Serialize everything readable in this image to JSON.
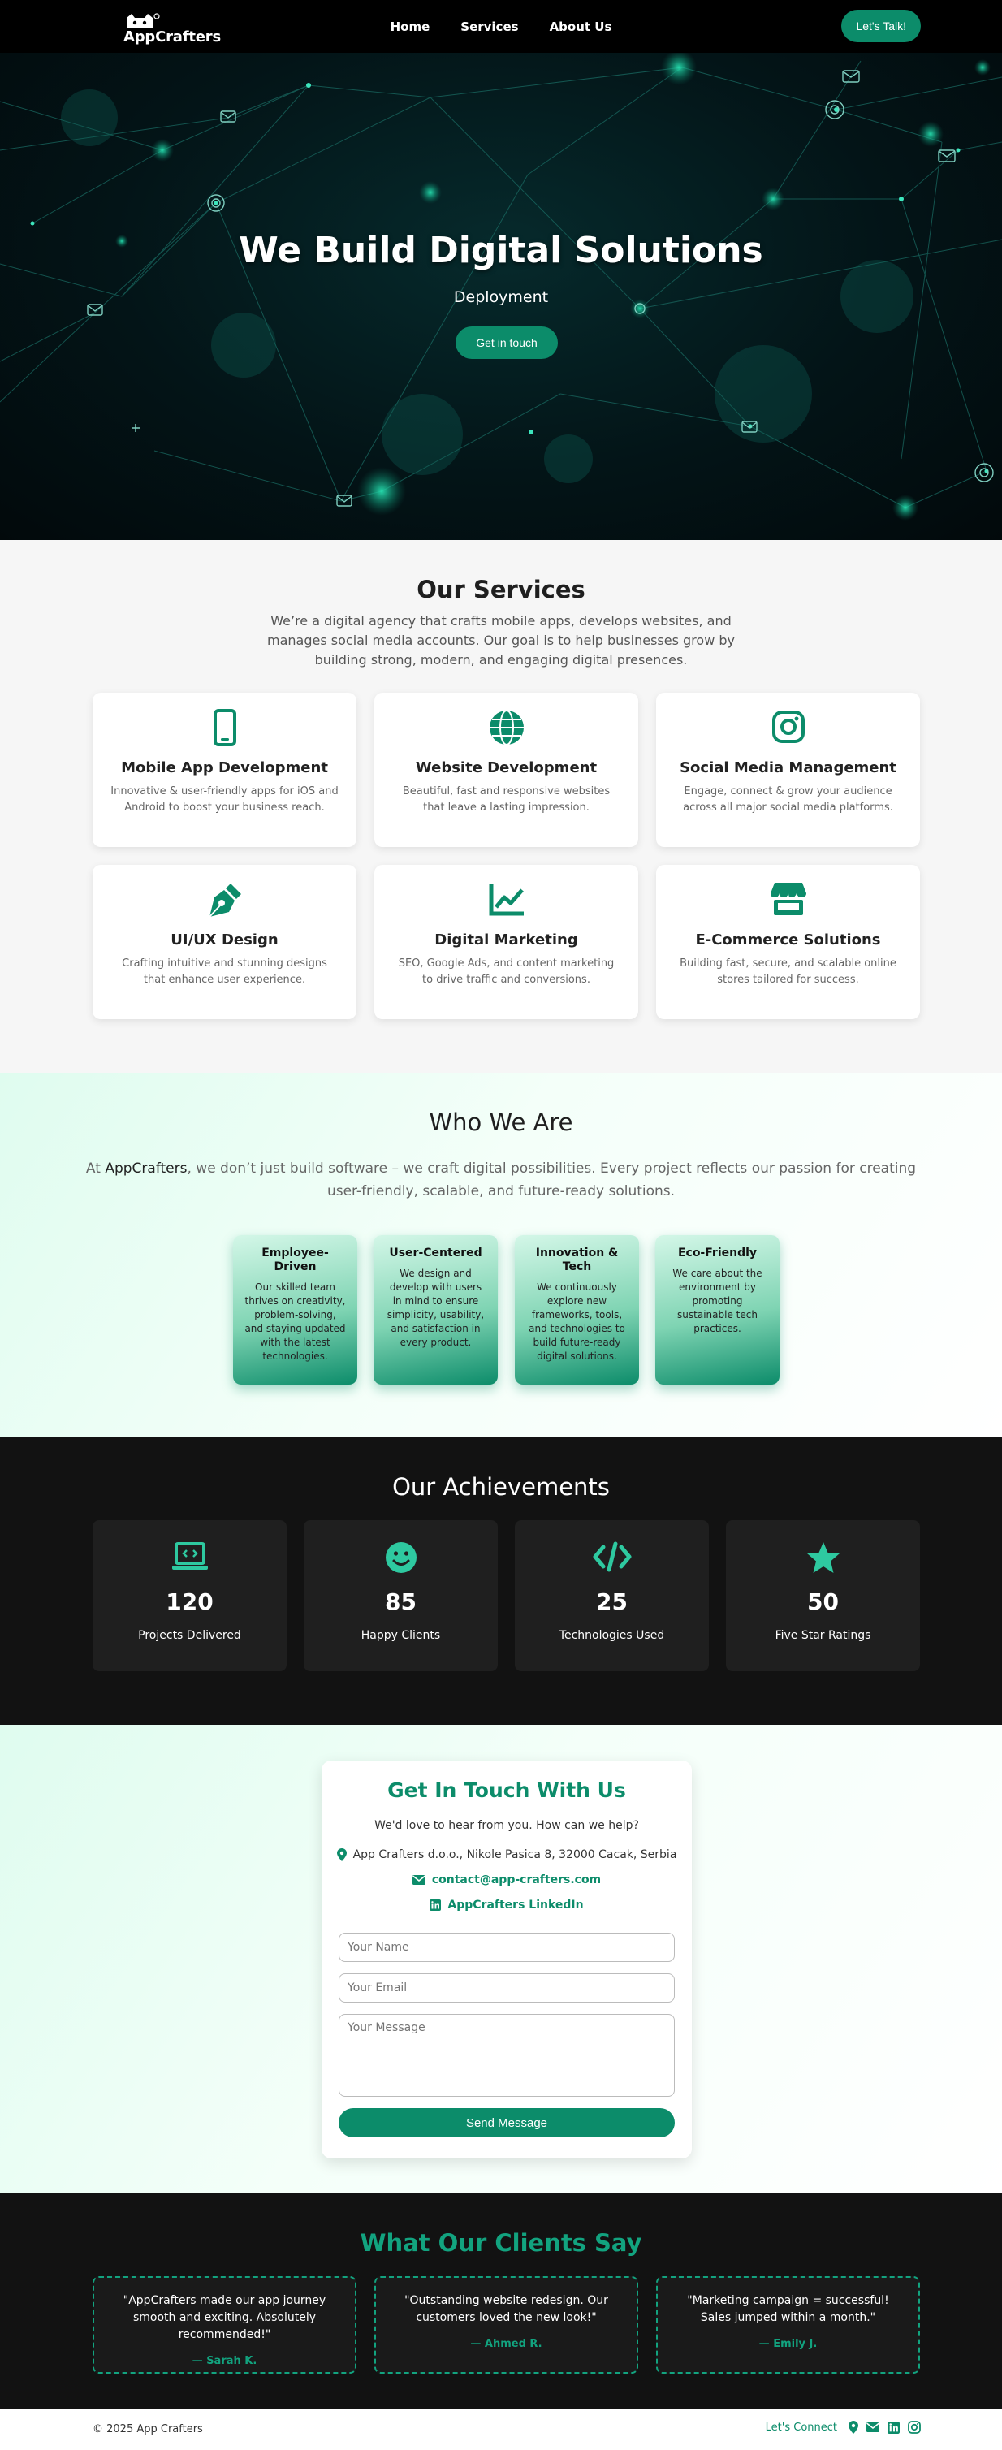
{
  "nav": {
    "logo_text": "AppCrafters",
    "links": [
      "Home",
      "Services",
      "About Us"
    ],
    "cta": "Let's Talk!"
  },
  "hero": {
    "title": "We Build Digital Solutions",
    "subtitle": "Deployment",
    "button": "Get in touch"
  },
  "services": {
    "title": "Our Services",
    "intro": "We’re a digital agency that crafts mobile apps, develops websites, and manages social media accounts. Our goal is to help businesses grow by building strong, modern, and engaging digital presences.",
    "items": [
      {
        "icon": "mobile-phone-icon",
        "title": "Mobile App Development",
        "desc": "Innovative & user-friendly apps for iOS and Android to boost your business reach."
      },
      {
        "icon": "globe-icon",
        "title": "Website Development",
        "desc": "Beautiful, fast and responsive websites that leave a lasting impression."
      },
      {
        "icon": "instagram-icon",
        "title": "Social Media Management",
        "desc": "Engage, connect & grow your audience across all major social media platforms."
      },
      {
        "icon": "pen-nib-icon",
        "title": "UI/UX Design",
        "desc": "Crafting intuitive and stunning designs that enhance user experience."
      },
      {
        "icon": "chart-line-icon",
        "title": "Digital Marketing",
        "desc": "SEO, Google Ads, and content marketing to drive traffic and conversions."
      },
      {
        "icon": "store-icon",
        "title": "E-Commerce Solutions",
        "desc": "Building fast, secure, and scalable online stores tailored for success."
      }
    ]
  },
  "who": {
    "title": "Who We Are",
    "intro_prefix": "At ",
    "intro_brand": "AppCrafters",
    "intro_rest": ", we don’t just build software – we craft digital possibilities. Every project reflects our passion for creating user-friendly, scalable, and future-ready solutions.",
    "values": [
      {
        "title": "Employee-Driven",
        "desc": "Our skilled team thrives on creativity, problem-solving, and staying updated with the latest technologies."
      },
      {
        "title": "User-Centered",
        "desc": "We design and develop with users in mind to ensure simplicity, usability, and satisfaction in every product."
      },
      {
        "title": "Innovation & Tech",
        "desc": "We continuously explore new frameworks, tools, and technologies to build future-ready digital solutions."
      },
      {
        "title": "Eco-Friendly",
        "desc": "We care about the environment by promoting sustainable tech practices."
      }
    ]
  },
  "achievements": {
    "title": "Our Achievements",
    "items": [
      {
        "icon": "laptop-code-icon",
        "number": "120",
        "label": "Projects Delivered"
      },
      {
        "icon": "smile-icon",
        "number": "85",
        "label": "Happy Clients"
      },
      {
        "icon": "code-icon",
        "number": "25",
        "label": "Technologies Used"
      },
      {
        "icon": "star-icon",
        "number": "50",
        "label": "Five Star Ratings"
      }
    ]
  },
  "contact": {
    "title": "Get In Touch With Us",
    "lead": "We'd love to hear from you. How can we help?",
    "address": "App Crafters d.o.o., Nikole Pasica 8, 32000 Cacak, Serbia",
    "email": "contact@app-crafters.com",
    "linkedin": "AppCrafters LinkedIn",
    "name_placeholder": "Your Name",
    "email_placeholder": "Your Email",
    "message_placeholder": "Your Message",
    "send": "Send Message"
  },
  "testimonials": {
    "title": "What Our Clients Say",
    "items": [
      {
        "quote": "\"AppCrafters made our app journey smooth and exciting. Absolutely recommended!\"",
        "author": "— Sarah K."
      },
      {
        "quote": "\"Outstanding website redesign. Our customers loved the new look!\"",
        "author": "— Ahmed R."
      },
      {
        "quote": "\"Marketing campaign = successful! Sales jumped within a month.\"",
        "author": "— Emily J."
      }
    ]
  },
  "footer": {
    "copyright": "© 2025 App Crafters",
    "connect": "Let's Connect"
  },
  "colors": {
    "accent": "#0c8c6a",
    "accent_light": "#12a37f",
    "dark": "#121212"
  }
}
